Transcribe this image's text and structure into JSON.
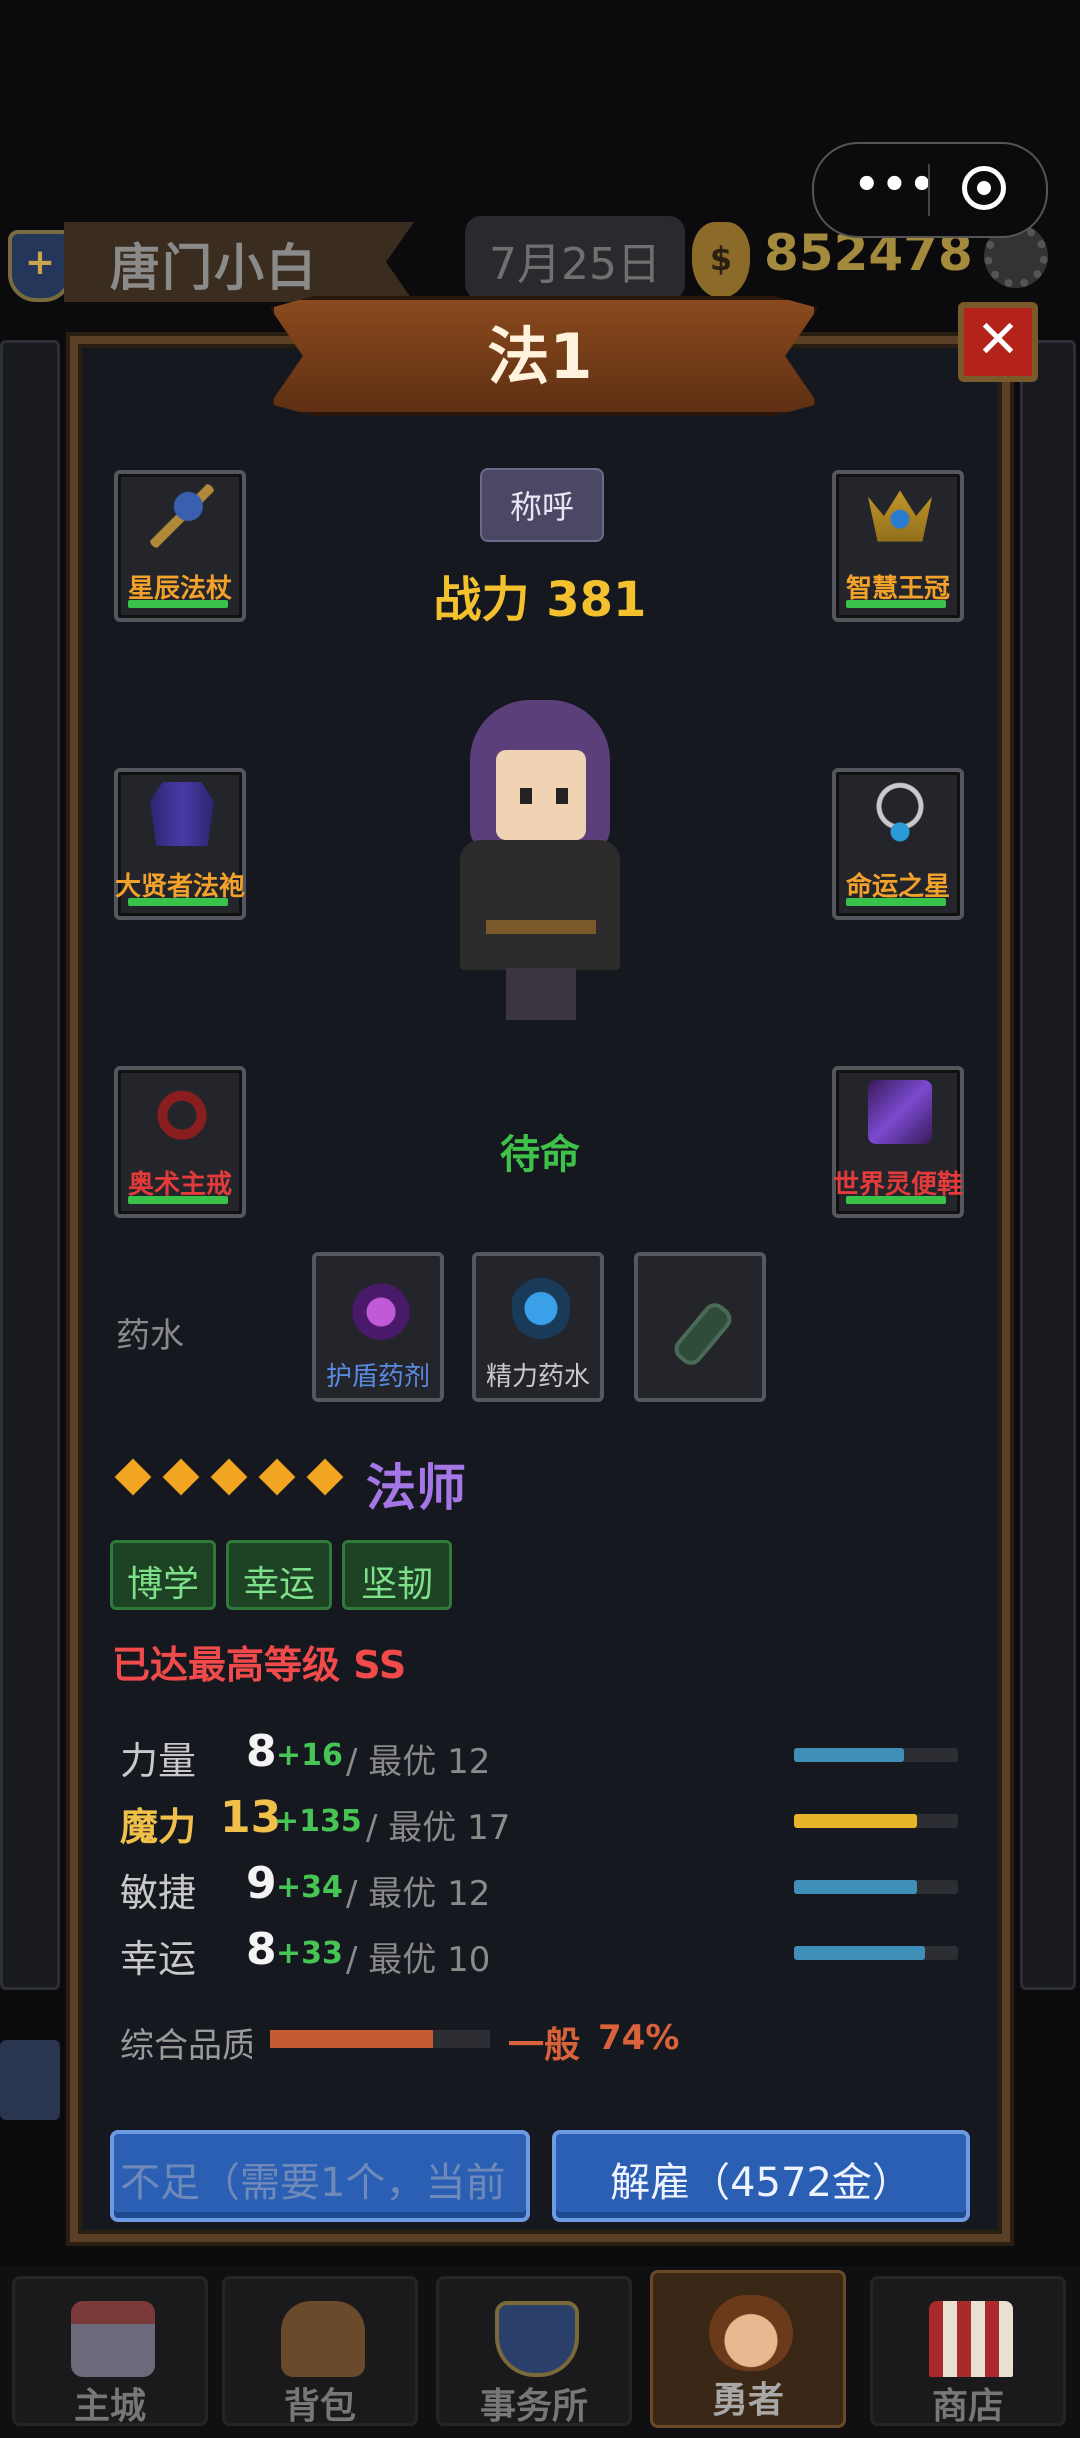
{
  "header": {
    "player_name": "唐门小白",
    "date": "7月25日",
    "gold": "852478",
    "shield_glyph": "+",
    "coin_glyph": "$"
  },
  "capsule": {
    "menu_dots": "•••"
  },
  "dialog": {
    "title": "法1",
    "close_glyph": "✕",
    "title_badge": "称呼",
    "power": "战力 381",
    "status": "待命"
  },
  "equipment": {
    "weapon": {
      "label": "星辰法杖",
      "icon": "staff-icon"
    },
    "head": {
      "label": "智慧王冠",
      "icon": "crown-icon"
    },
    "armor": {
      "label": "大贤者法袍",
      "icon": "robe-icon"
    },
    "necklace": {
      "label": "命运之星",
      "icon": "necklace-icon"
    },
    "ring": {
      "label": "奥术主戒",
      "icon": "ring-icon"
    },
    "boots": {
      "label": "世界灵便鞋",
      "icon": "boots-icon"
    }
  },
  "potions": {
    "label": "药水",
    "slots": [
      {
        "label": "护盾药剂",
        "icon": "shield-potion-icon"
      },
      {
        "label": "精力药水",
        "icon": "energy-potion-icon"
      },
      {
        "label": "",
        "icon": "empty-tube-icon"
      }
    ]
  },
  "hero_class": {
    "stars": 5,
    "name": "法师",
    "traits": [
      "博学",
      "幸运",
      "坚韧"
    ],
    "level_note": "已达最高等级 SS"
  },
  "stats": [
    {
      "name": "力量",
      "value": "8",
      "bonus": "+16",
      "best": "/ 最优 12",
      "fill": 0.67,
      "color": "#3f8fb8",
      "highlight": false
    },
    {
      "name": "魔力",
      "value": "13",
      "bonus": "+135",
      "best": "/ 最优 17",
      "fill": 0.75,
      "color": "#e8b52a",
      "highlight": true
    },
    {
      "name": "敏捷",
      "value": "9",
      "bonus": "+34",
      "best": "/ 最优 12",
      "fill": 0.75,
      "color": "#3f8fb8",
      "highlight": false
    },
    {
      "name": "幸运",
      "value": "8",
      "bonus": "+33",
      "best": "/ 最优 10",
      "fill": 0.8,
      "color": "#3f8fb8",
      "highlight": false
    }
  ],
  "quality": {
    "label": "综合品质",
    "word": "一般",
    "percent": "74%",
    "fill": 0.74
  },
  "buttons": {
    "left": "不足（需要1个，当前",
    "dismiss": "解雇（4572金）"
  },
  "nav": [
    {
      "label": "主城",
      "icon": "castle-icon",
      "active": false
    },
    {
      "label": "背包",
      "icon": "backpack-icon",
      "active": false
    },
    {
      "label": "事务所",
      "icon": "guild-shield-icon",
      "active": false
    },
    {
      "label": "勇者",
      "icon": "hero-face-icon",
      "active": true
    },
    {
      "label": "商店",
      "icon": "shop-icon",
      "active": false
    }
  ],
  "colors": {
    "gold_text": "#a38a3c",
    "power_text": "#f4c12e",
    "status_green": "#3ec24a",
    "class_purple": "#a476e6",
    "dismiss_blue": "#2a5fb3"
  }
}
